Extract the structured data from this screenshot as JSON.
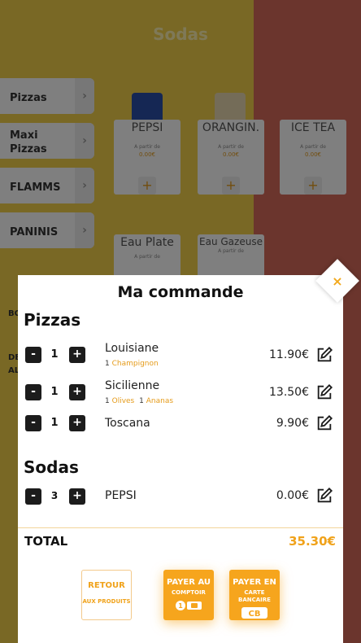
{
  "background": {
    "title": "Sodas",
    "categories": [
      "Pizzas",
      "Maxi Pizzas",
      "FLAMMS",
      "PANINIS"
    ],
    "partial_categories": [
      "BO",
      "DE",
      "AL"
    ],
    "products": [
      {
        "name": "PEPSI",
        "apartir": "A partir de",
        "price": "0.00€"
      },
      {
        "name": "ORANGIN.",
        "apartir": "A partir de",
        "price": "0.00€"
      },
      {
        "name": "ICE TEA",
        "apartir": "A partir de",
        "price": "0.00€"
      },
      {
        "name": "Eau Plate",
        "apartir": "A partir de"
      },
      {
        "name": "Eau Gazeuse",
        "apartir": "A partir de"
      }
    ],
    "plus": "+"
  },
  "modal": {
    "title": "Ma commande",
    "close_label": "×",
    "sections": [
      {
        "title": "Pizzas",
        "items": [
          {
            "qty": "1",
            "name": "Louisiane",
            "price": "11.90€",
            "options": [
              {
                "count": "1",
                "label": "Champignon"
              }
            ]
          },
          {
            "qty": "1",
            "name": "Sicilienne",
            "price": "13.50€",
            "options": [
              {
                "count": "1",
                "label": "Olives"
              },
              {
                "count": "1",
                "label": "Ananas"
              }
            ]
          },
          {
            "qty": "1",
            "name": "Toscana",
            "price": "9.90€",
            "options": []
          }
        ]
      },
      {
        "title": "Sodas",
        "items": [
          {
            "qty": "3",
            "name": "PEPSI",
            "price": "0.00€",
            "options": []
          }
        ]
      }
    ],
    "minus": "-",
    "plus": "+",
    "total_label": "TOTAL",
    "total_value": "35.30€",
    "buttons": {
      "retour": {
        "line1": "RETOUR",
        "line2": "AUX PRODUITS"
      },
      "comptoir": {
        "line1": "PAYER AU",
        "line2": "COMPTOIR",
        "icon_text": "1"
      },
      "carte": {
        "line1": "PAYER EN",
        "line2": "CARTE BANCAIRE",
        "icon_text": "CB"
      }
    }
  },
  "colors": {
    "accent": "#f6a51d",
    "yellow": "#f2d04a",
    "red": "#d66a5a"
  }
}
